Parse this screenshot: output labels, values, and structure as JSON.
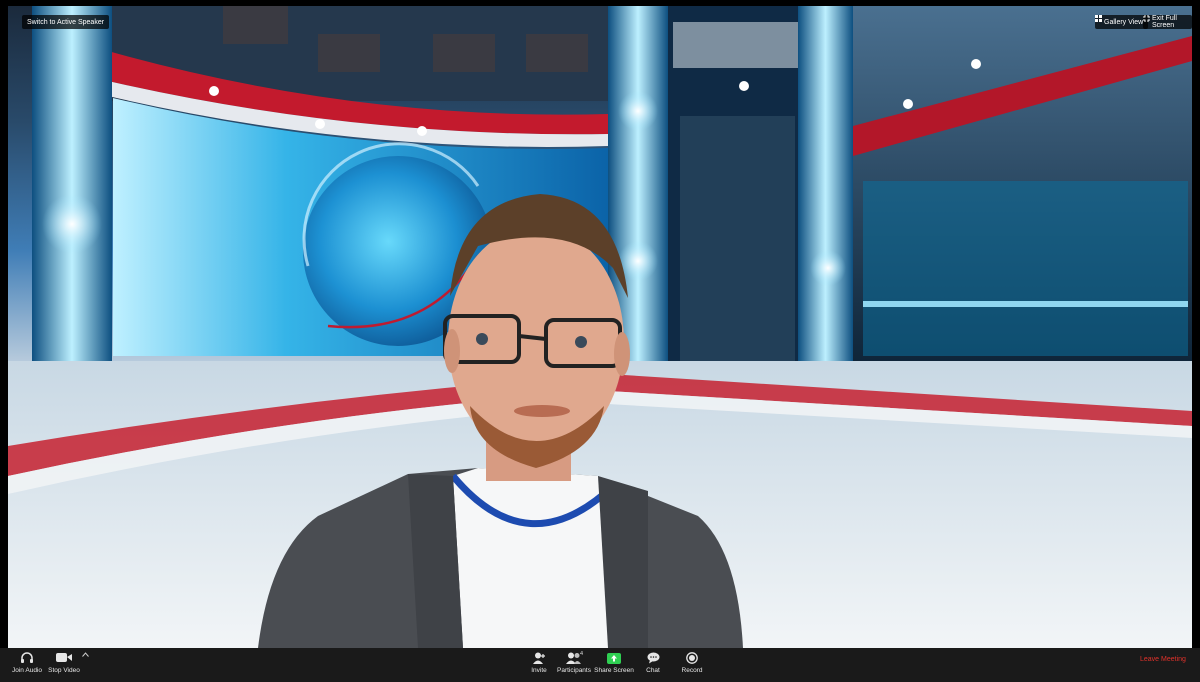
{
  "top_controls": {
    "switch_label": "Switch to Active Speaker",
    "gallery_label": "Gallery View",
    "exit_label": "Exit Full Screen"
  },
  "toolbar": {
    "join_audio": "Join Audio",
    "stop_video": "Stop Video",
    "invite": "Invite",
    "participants": "Participants",
    "participant_count": "4",
    "share_screen": "Share Screen",
    "chat": "Chat",
    "record": "Record",
    "leave": "Leave Meeting"
  },
  "colors": {
    "leave": "#e0322b",
    "share": "#2fcf52",
    "toolbar": "#1a1a1a"
  },
  "icons": [
    "headphone-icon",
    "camera-icon",
    "chevron-up-icon",
    "invite-person-icon",
    "participants-icon",
    "share-screen-icon",
    "chat-bubble-icon",
    "record-icon",
    "grid-icon",
    "exit-fullscreen-icon"
  ]
}
